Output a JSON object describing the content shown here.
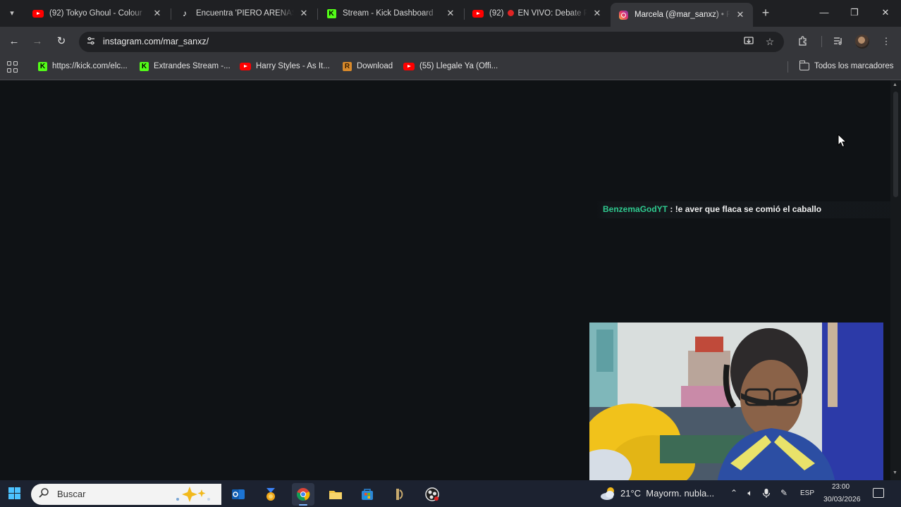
{
  "browser": {
    "tabs": [
      {
        "title": "(92) Tokyo Ghoul - Colour",
        "favicon": "youtube-icon"
      },
      {
        "title": "Encuentra 'PIERO ARENAS' e",
        "favicon": "tiktok-icon"
      },
      {
        "title": "Stream - Kick Dashboard",
        "favicon": "kick-icon"
      },
      {
        "title_prefix": "(92)",
        "title": "EN VIVO: Debate Pr",
        "favicon": "youtube-icon",
        "live": true
      },
      {
        "title": "Marcela (@mar_sanxz) • Fot",
        "favicon": "instagram-icon",
        "active": true
      }
    ],
    "url": "instagram.com/mar_sanxz/",
    "bookmarks": [
      {
        "label": "https://kick.com/elc...",
        "favicon": "kick-icon"
      },
      {
        "label": "Extrandes Stream -...",
        "favicon": "kick-icon"
      },
      {
        "label": "Harry Styles - As It...",
        "favicon": "youtube-icon"
      },
      {
        "label": "Download",
        "favicon": "r-icon"
      },
      {
        "label": "(55) Llegale Ya (Offi...",
        "favicon": "youtube-icon"
      }
    ],
    "all_bookmarks_label": "Todos los marcadores"
  },
  "overlay": {
    "chat": {
      "username": "BenzemaGodYT",
      "separator": " : ",
      "message": "!e aver que flaca se comió el caballo",
      "username_color": "#2fc98f"
    },
    "webcam": {
      "description_icon": "webcam-feed"
    }
  },
  "taskbar": {
    "search_placeholder": "Buscar",
    "weather": {
      "temp": "21°C",
      "condition": "Mayorm. nubla..."
    },
    "language": "ESP",
    "time": "23:00",
    "date": "30/03/2026"
  }
}
